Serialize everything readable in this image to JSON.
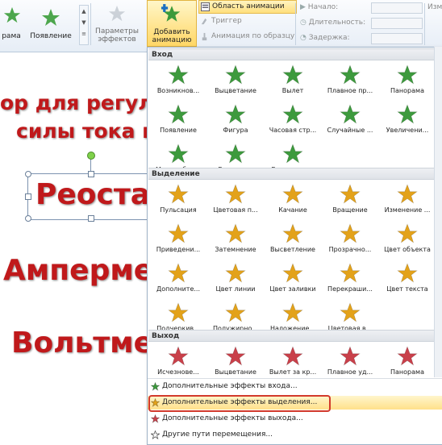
{
  "ribbon": {
    "left_partial": "рама",
    "appear_label": "Появление",
    "effects_label_1": "Параметры",
    "effects_label_2": "эффектов",
    "add_label_1": "Добавить",
    "add_label_2": "анимацию",
    "small_buttons": [
      "Область анимации",
      "Триггер",
      "Анимация по образцу"
    ],
    "timing": [
      "Начало:",
      "Длительность:",
      "Задержка:"
    ],
    "right_partial": "Изм"
  },
  "slide": {
    "line1": "ор для регули",
    "line2": "силы тока в ц",
    "word1": "Реостат",
    "word2": "Амперме",
    "word3": "Вольтмет"
  },
  "menu": {
    "sections": [
      {
        "title": "Вход",
        "rows": [
          [
            "Возникнов...",
            "Выцветание",
            "Вылет",
            "Плавное пр...",
            "Панорама"
          ],
          [
            "Появление",
            "Фигура",
            "Часовая стр...",
            "Случайные ...",
            "Увеличени..."
          ],
          [
            "Масштабир...",
            "Вращение",
            "Выскакива..."
          ]
        ]
      },
      {
        "title": "Выделение",
        "rows": [
          [
            "Пульсация",
            "Цветовая п...",
            "Качание",
            "Вращение",
            "Изменение ..."
          ],
          [
            "Приведени...",
            "Затемнение",
            "Высветление",
            "Прозрачно...",
            "Цвет объекта"
          ],
          [
            "Дополните...",
            "Цвет линии",
            "Цвет заливки",
            "Перекраши...",
            "Цвет текста"
          ],
          [
            "Подчеркив...",
            "Полужирно...",
            "Наложение...",
            "Цветовая в..."
          ]
        ]
      },
      {
        "title": "Выход",
        "rows": [
          [
            "Исчезнове...",
            "Выцветание",
            "Вылет за кр...",
            "Плавное уд...",
            "Панорама"
          ]
        ]
      }
    ],
    "more_items": [
      "Дополнительные эффекты входа...",
      "Дополнительные эффекты выделения...",
      "Дополнительные эффекты выхода...",
      "Другие пути перемещения..."
    ],
    "highlighted_index": 1
  },
  "colors": {
    "entrance": "#3d9a3d",
    "emphasis": "#e3a21a",
    "exit": "#c9404a",
    "slide_text": "#c0191b",
    "highlight_border": "#d23a2c"
  }
}
